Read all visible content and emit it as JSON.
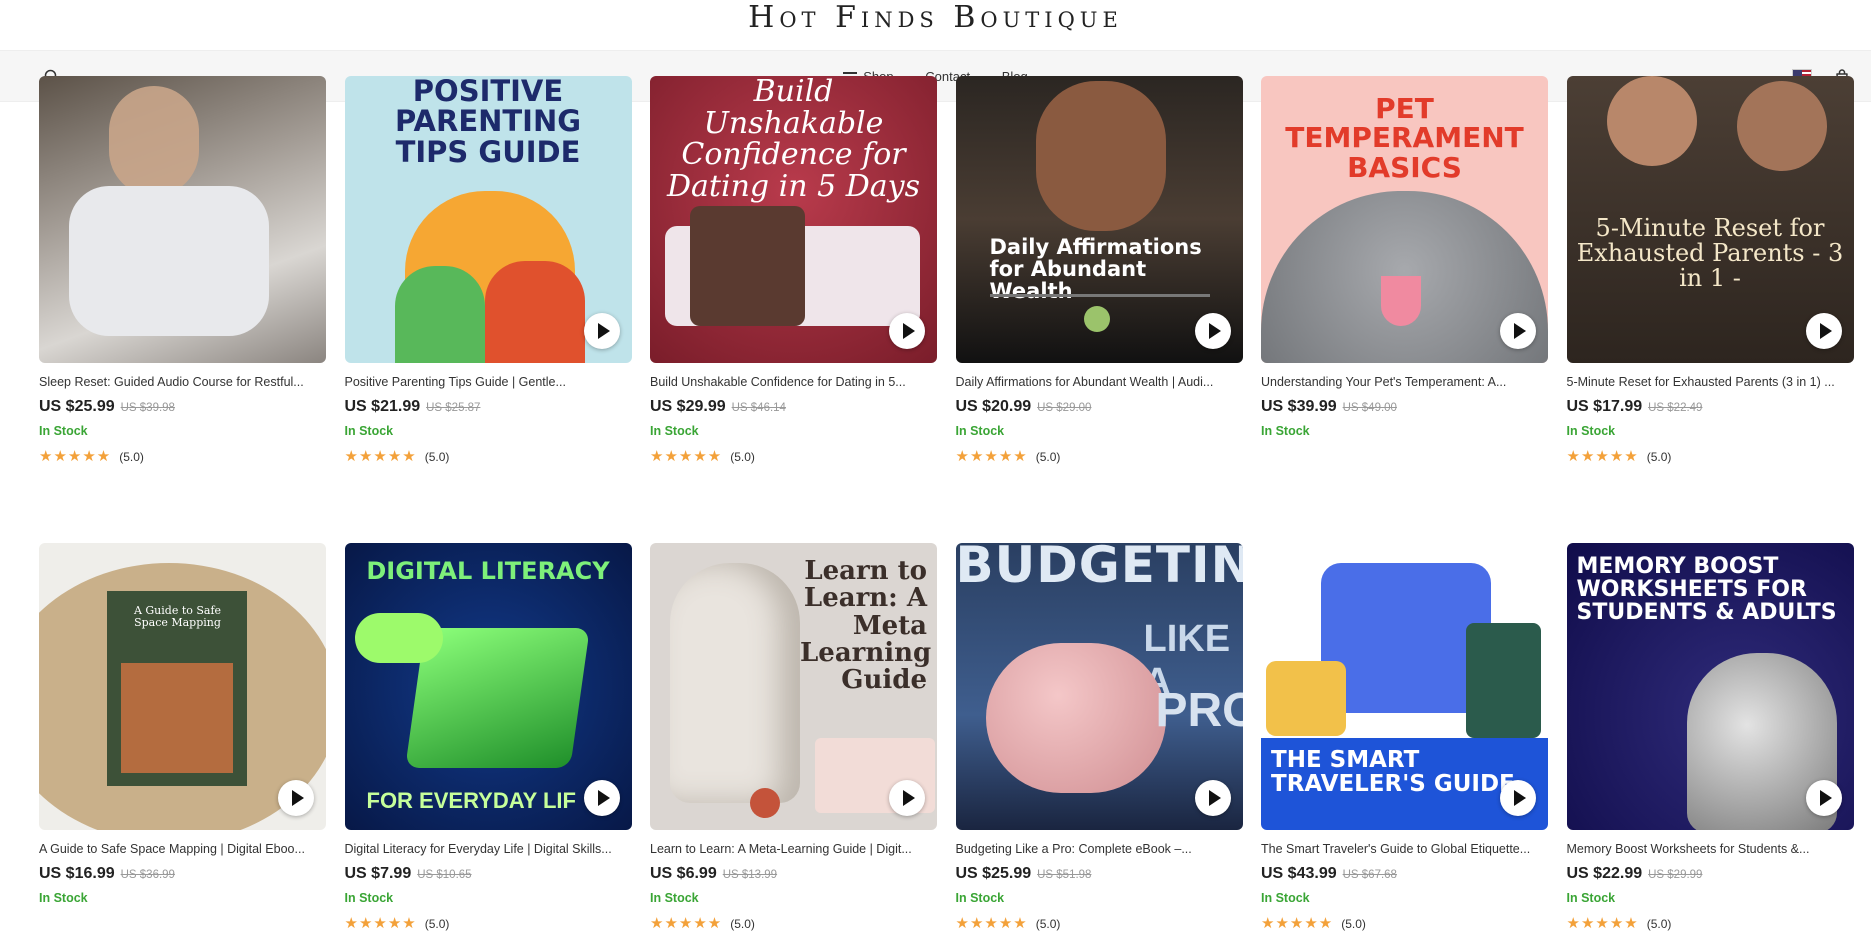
{
  "header": {
    "brand": "Hot Finds Boutique",
    "nav": [
      {
        "label": "Shop",
        "icon": "menu-icon"
      },
      {
        "label": "Contact"
      },
      {
        "label": "Blog"
      }
    ],
    "icons": {
      "search": "search-icon",
      "flag": "us-flag-icon",
      "cart": "shopping-bag-icon"
    }
  },
  "colors": {
    "in_stock": "#3aa535",
    "star": "#f3a13a",
    "nav_bg": "#f6f6f6"
  },
  "products": [
    {
      "title": "Sleep Reset: Guided Audio Course for Restful...",
      "price": "US $25.99",
      "old_price": "US $39.98",
      "stock": "In Stock",
      "rating": "(5.0)",
      "art": ""
    },
    {
      "title": "Positive Parenting Tips Guide | Gentle...",
      "price": "US $21.99",
      "old_price": "US $25.87",
      "stock": "In Stock",
      "rating": "(5.0)",
      "art": "POSITIVE PARENTING TIPS GUIDE"
    },
    {
      "title": "Build Unshakable Confidence for Dating in 5...",
      "price": "US $29.99",
      "old_price": "US $46.14",
      "stock": "In Stock",
      "rating": "(5.0)",
      "art": "Build Unshakable Confidence for Dating in 5 Days"
    },
    {
      "title": "Daily Affirmations for Abundant Wealth | Audi...",
      "price": "US $20.99",
      "old_price": "US $29.00",
      "stock": "In Stock",
      "rating": "(5.0)",
      "art": "Daily Affirmations for Abundant Wealth"
    },
    {
      "title": "Understanding Your Pet's Temperament: A...",
      "price": "US $39.99",
      "old_price": "US $49.00",
      "stock": "In Stock",
      "rating": "",
      "art": "PET TEMPERAMENT BASICS"
    },
    {
      "title": "5-Minute Reset for Exhausted Parents (3 in 1) ...",
      "price": "US $17.99",
      "old_price": "US $22.49",
      "stock": "In Stock",
      "rating": "(5.0)",
      "art": "5-Minute Reset for Exhausted Parents - 3 in 1 -"
    },
    {
      "title": "A Guide to Safe Space Mapping | Digital Eboo...",
      "price": "US $16.99",
      "old_price": "US $36.99",
      "stock": "In Stock",
      "rating": "",
      "art": "A Guide to Safe Space Mapping"
    },
    {
      "title": "Digital Literacy for Everyday Life | Digital Skills...",
      "price": "US $7.99",
      "old_price": "US $10.65",
      "stock": "In Stock",
      "rating": "(5.0)",
      "art": "DIGITAL LITERACY"
    },
    {
      "title": "Learn to Learn: A Meta-Learning Guide | Digit...",
      "price": "US $6.99",
      "old_price": "US $13.99",
      "stock": "In Stock",
      "rating": "(5.0)",
      "art": "Learn to Learn: A Meta Learning Guide"
    },
    {
      "title": "Budgeting Like a Pro: Complete eBook –...",
      "price": "US $25.99",
      "old_price": "US $51.98",
      "stock": "In Stock",
      "rating": "(5.0)",
      "art": "BUDGETING LIKE A PRO"
    },
    {
      "title": "The Smart Traveler's Guide to Global Etiquette...",
      "price": "US $43.99",
      "old_price": "US $67.68",
      "stock": "In Stock",
      "rating": "(5.0)",
      "art": "THE SMART TRAVELER'S GUIDE"
    },
    {
      "title": "Memory Boost Worksheets for Students &...",
      "price": "US $22.99",
      "old_price": "US $29.99",
      "stock": "In Stock",
      "rating": "(5.0)",
      "art": "MEMORY BOOST WORKSHEETS FOR STUDENTS & ADULTS"
    }
  ]
}
